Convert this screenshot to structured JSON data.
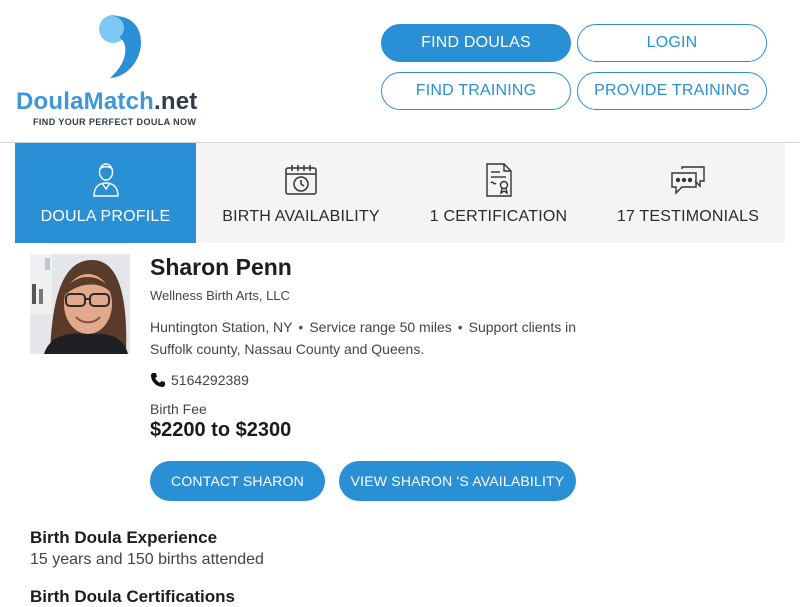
{
  "brand": {
    "name_part1": "Doula",
    "name_part2": "Match",
    "name_part3": ".net",
    "tagline": "FIND YOUR PERFECT DOULA NOW",
    "colors": {
      "primary": "#2a90d5",
      "logo_light": "#7cc8f2",
      "dark": "#2f3b4a",
      "tab_bg": "#f4f4f4"
    }
  },
  "nav": {
    "find_doulas": "FIND DOULAS",
    "login": "LOGIN",
    "find_training": "FIND TRAINING",
    "provide_training": "PROVIDE TRAINING"
  },
  "tabs": [
    {
      "label": "DOULA PROFILE",
      "icon": "doula-person-icon",
      "active": true
    },
    {
      "label": "BIRTH AVAILABILITY",
      "icon": "calendar-clock-icon",
      "active": false
    },
    {
      "label": "1 CERTIFICATION",
      "icon": "certificate-icon",
      "active": false
    },
    {
      "label": "17 TESTIMONIALS",
      "icon": "chat-bubbles-icon",
      "active": false
    }
  ],
  "profile": {
    "name": "Sharon Penn",
    "business": "Wellness Birth Arts, LLC",
    "location": "Huntington Station, NY",
    "service_range": "Service range 50 miles",
    "support_line": "Support clients in",
    "support_area": "Suffolk county, Nassau County and Queens.",
    "phone": "5164292389",
    "fee_label": "Birth Fee",
    "fee": "$2200 to $2300",
    "contact_button": "CONTACT SHARON",
    "availability_button": "VIEW SHARON 'S AVAILABILITY"
  },
  "sections": [
    {
      "heading": "Birth Doula Experience",
      "text": "15 years and 150 births attended"
    },
    {
      "heading": "Birth Doula Certifications",
      "text": ""
    }
  ]
}
